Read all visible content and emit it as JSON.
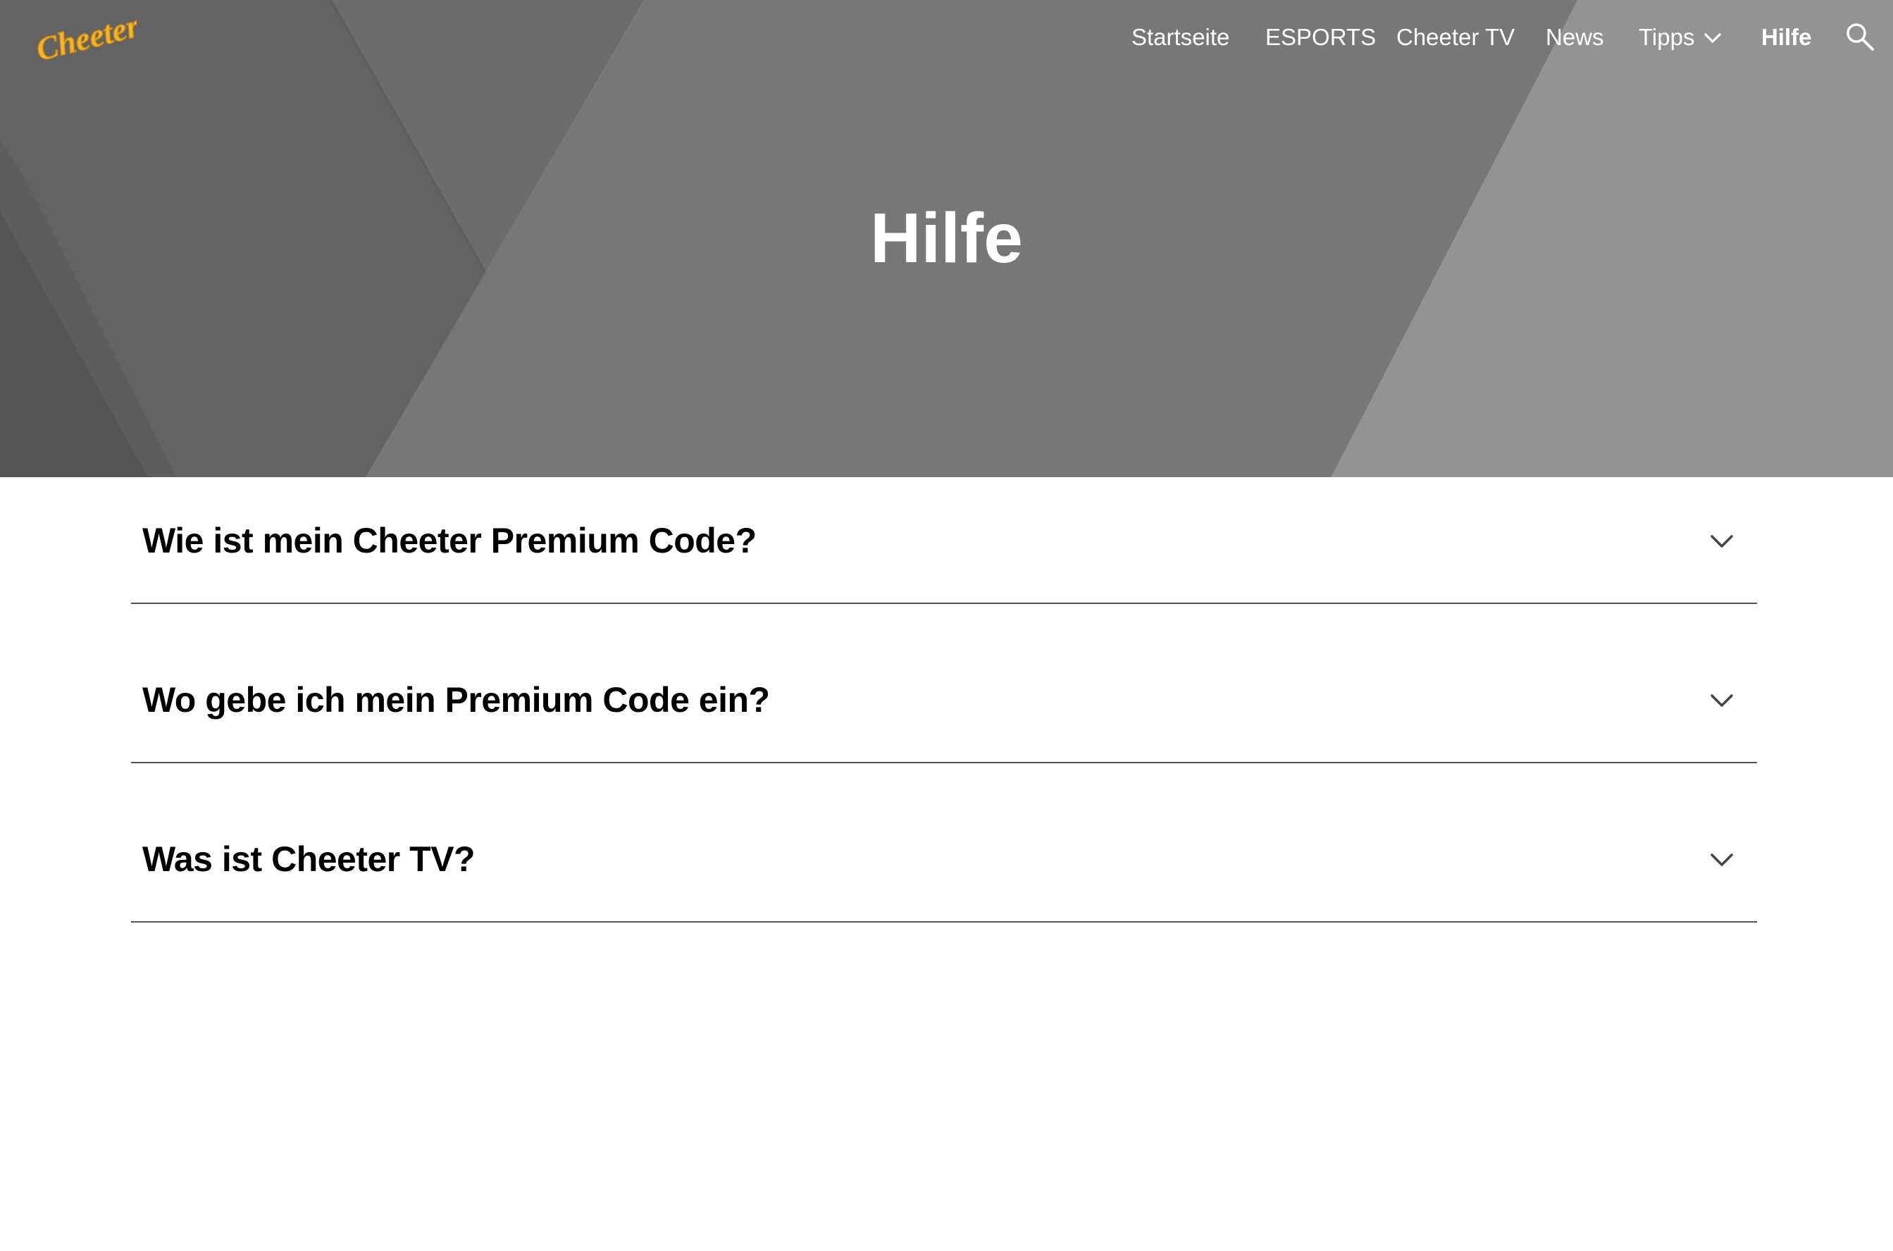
{
  "brand": {
    "logo_text": "Cheeter",
    "logo_color": "#f7b32b"
  },
  "nav": {
    "items": [
      {
        "label": "Startseite"
      },
      {
        "label": "ESPORTS"
      },
      {
        "label": "Cheeter TV"
      },
      {
        "label": "News"
      },
      {
        "label": "Tipps",
        "has_dropdown": true
      },
      {
        "label": "Hilfe",
        "active": true
      }
    ],
    "search_icon": "search-icon"
  },
  "hero": {
    "title": "Hilfe"
  },
  "faq": [
    {
      "question": "Wie ist mein Cheeter Premium Code?",
      "expanded": false
    },
    {
      "question": "Wo gebe ich mein Premium Code ein?",
      "expanded": false
    },
    {
      "question": "Was ist Cheeter TV?",
      "expanded": false
    }
  ],
  "colors": {
    "hero_gray": "#6e6e6e",
    "text_dark": "#000000",
    "divider": "#555555"
  }
}
